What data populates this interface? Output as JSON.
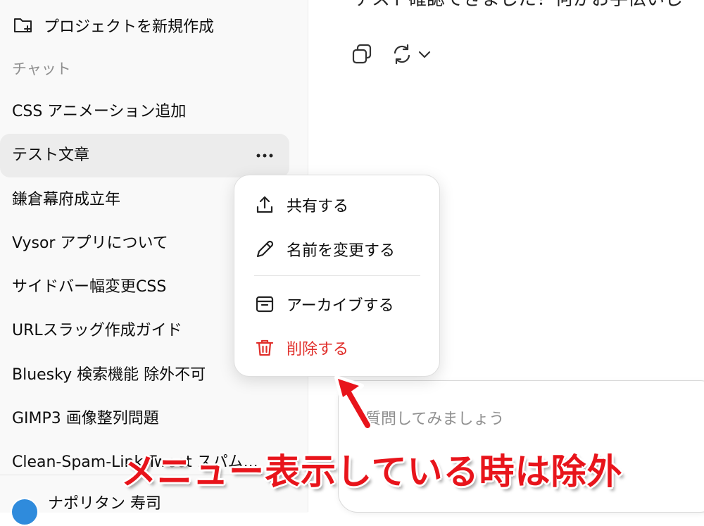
{
  "sidebar": {
    "new_project_label": "プロジェクトを新規作成",
    "section_label": "チャット",
    "chats": [
      {
        "label": "CSS アニメーション追加"
      },
      {
        "label": "テスト文章"
      },
      {
        "label": "鎌倉幕府成立年"
      },
      {
        "label": "Vysor アプリについて"
      },
      {
        "label": "サイドバー幅変更CSS"
      },
      {
        "label": "URLスラッグ作成ガイド"
      },
      {
        "label": "Bluesky 検索機能 除外不可"
      },
      {
        "label": "GIMP3 画像整列問題"
      },
      {
        "label": "Clean-Spam-Link-Tweet スパム..."
      }
    ],
    "profile_name": "ナポリタン 寿司"
  },
  "main": {
    "message_text": "テスト確認できました！何かお手伝いし",
    "composer_placeholder": "質問してみましょう"
  },
  "menu": {
    "share": "共有する",
    "rename": "名前を変更する",
    "archive": "アーカイブする",
    "delete": "削除する"
  },
  "annotation": {
    "text": "メニュー表示している時は除外",
    "color": "#e8141b"
  },
  "colors": {
    "danger": "#e02e2a",
    "sidebar_bg": "#f9f9f9",
    "active_item_bg": "#ececec"
  }
}
